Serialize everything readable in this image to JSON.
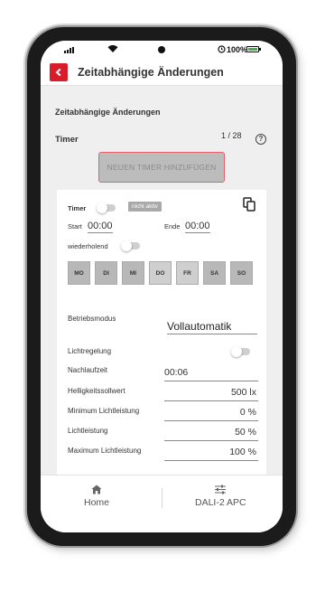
{
  "status_bar": {
    "battery": "100%",
    "battery_color": "#3fb24a"
  },
  "header": {
    "title": "Zeitabhängige Änderungen"
  },
  "section": {
    "title": "Zeitabhängige Änderungen"
  },
  "timer": {
    "title": "Timer",
    "count": "1 / 28",
    "add_button": "NEUEN TIMER HINZUFÜGEN",
    "help_icon": "?"
  },
  "card": {
    "timer_label": "Timer",
    "status_badge": "nicht aktiv",
    "start_label": "Start",
    "start_value": "00:00",
    "end_label": "Ende",
    "end_value": "00:00",
    "repeat_label": "wiederholend",
    "days": [
      "MO",
      "DI",
      "MI",
      "DO",
      "FR",
      "SA",
      "SO"
    ],
    "mode_label": "Betriebsmodus",
    "mode_value": "Vollautomatik",
    "light_control_label": "Lichtregelung",
    "delay_label": "Nachlaufzeit",
    "delay_value": "00:06",
    "brightness_label": "Helligkeitssollwert",
    "brightness_value": "500 lx",
    "min_light_label": "Minimum Lichtleistung",
    "min_light_value": "0 %",
    "light_output_label": "Lichtleistung",
    "light_output_value": "50 %",
    "max_light_label": "Maximum Lichtleistung",
    "max_light_value": "100 %"
  },
  "tabbar": {
    "home_label": "Home",
    "apc_label": "DALI-2 APC"
  },
  "colors": {
    "accent": "#d91c2a",
    "underline": "#e4606a",
    "toggle_off": "#cfcfcf"
  }
}
